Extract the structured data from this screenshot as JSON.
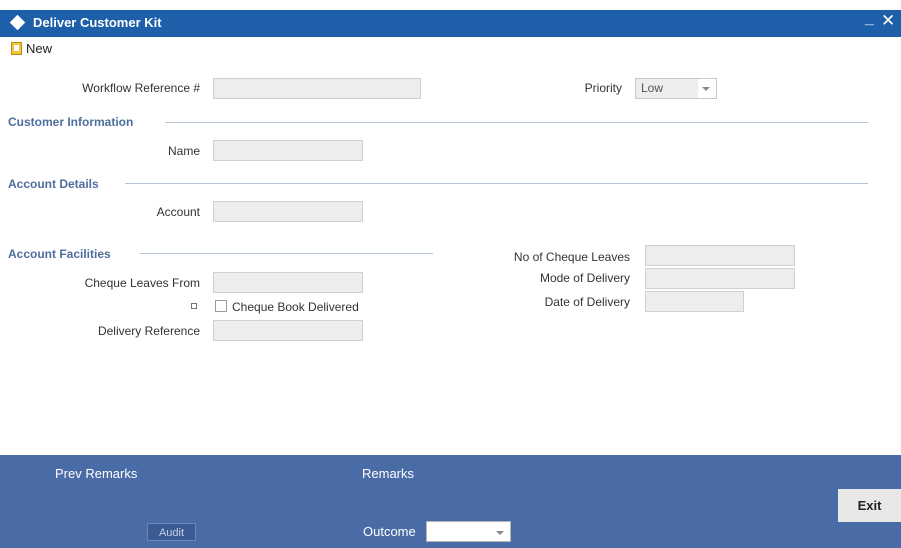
{
  "window": {
    "title": "Deliver Customer Kit",
    "minimize": "_",
    "close": "✕"
  },
  "toolbar": {
    "new_label": "New"
  },
  "header": {
    "workflow_ref_label": "Workflow Reference #",
    "workflow_ref_value": "",
    "priority_label": "Priority",
    "priority_value": "Low"
  },
  "customer_info": {
    "section": "Customer Information",
    "name_label": "Name",
    "name_value": ""
  },
  "account_details": {
    "section": "Account Details",
    "account_label": "Account",
    "account_value": ""
  },
  "account_facilities": {
    "section": "Account Facilities",
    "cheque_leaves_from_label": "Cheque Leaves From",
    "cheque_book_delivered_label": "Cheque Book Delivered",
    "cheque_book_delivered": false,
    "delivery_reference_label": "Delivery Reference",
    "no_of_cheque_leaves_label": "No of Cheque Leaves",
    "mode_of_delivery_label": "Mode of Delivery",
    "date_of_delivery_label": "Date of Delivery"
  },
  "footer": {
    "prev_remarks_label": "Prev Remarks",
    "remarks_label": "Remarks",
    "audit_label": "Audit",
    "outcome_label": "Outcome",
    "outcome_value": "",
    "exit_label": "Exit"
  },
  "icons": [
    "window-diamond-icon",
    "new-document-icon",
    "minimize-icon",
    "close-icon",
    "chevron-down-icon"
  ],
  "colors": {
    "titlebar": "#1d5fa8",
    "footer": "#4a6ca6",
    "section_text": "#4f6e9e"
  }
}
